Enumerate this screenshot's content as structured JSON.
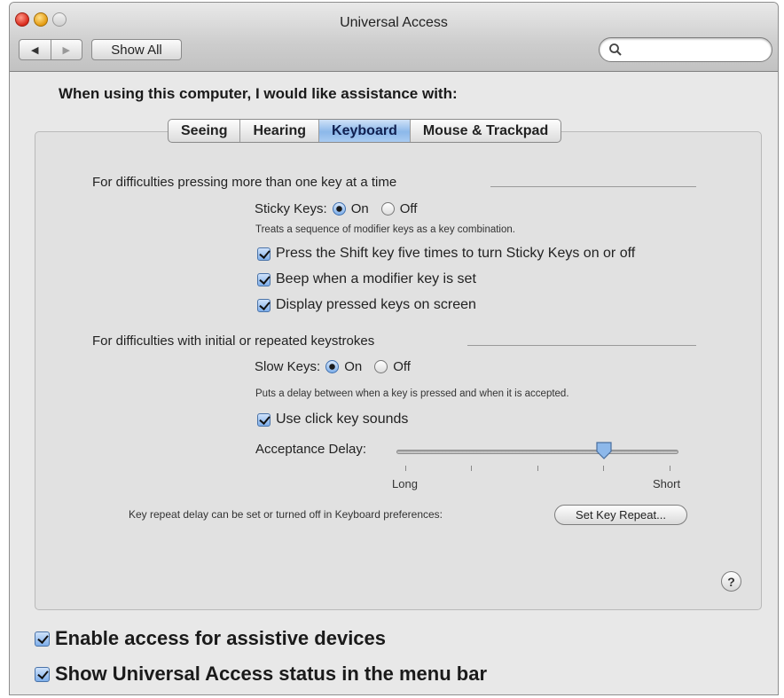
{
  "window": {
    "title": "Universal Access"
  },
  "toolbar": {
    "back": "◀",
    "forward": "▶",
    "show_all": "Show All",
    "search_placeholder": ""
  },
  "prompt": "When using this computer, I would like assistance with:",
  "tabs": [
    {
      "label": "Seeing",
      "active": false
    },
    {
      "label": "Hearing",
      "active": false
    },
    {
      "label": "Keyboard",
      "active": true
    },
    {
      "label": "Mouse & Trackpad",
      "active": false
    }
  ],
  "sticky": {
    "section_title": "For difficulties pressing more than one key at a time",
    "label": "Sticky Keys:",
    "on_label": "On",
    "off_label": "Off",
    "selected": "On",
    "description": "Treats a sequence of modifier keys as a key combination.",
    "options": [
      {
        "label": "Press the Shift key five times to turn Sticky Keys on or off",
        "checked": true
      },
      {
        "label": "Beep when a modifier key is set",
        "checked": true
      },
      {
        "label": "Display pressed keys on screen",
        "checked": true
      }
    ]
  },
  "slow": {
    "section_title": "For difficulties with initial or repeated keystrokes",
    "label": "Slow Keys:",
    "on_label": "On",
    "off_label": "Off",
    "selected": "On",
    "description": "Puts a delay between when a key is pressed and when it is accepted.",
    "click_sounds": {
      "label": "Use click key sounds",
      "checked": true
    },
    "acceptance": {
      "label": "Acceptance Delay:",
      "min_label": "Long",
      "max_label": "Short",
      "value_fraction": 0.72
    }
  },
  "key_repeat": {
    "text": "Key repeat delay can be set or turned off in Keyboard preferences:",
    "button": "Set Key Repeat..."
  },
  "help": "?",
  "bottom": {
    "assistive": {
      "label": "Enable access for assistive devices",
      "checked": true
    },
    "status": {
      "label": "Show Universal Access status in the menu bar",
      "checked": true
    }
  }
}
